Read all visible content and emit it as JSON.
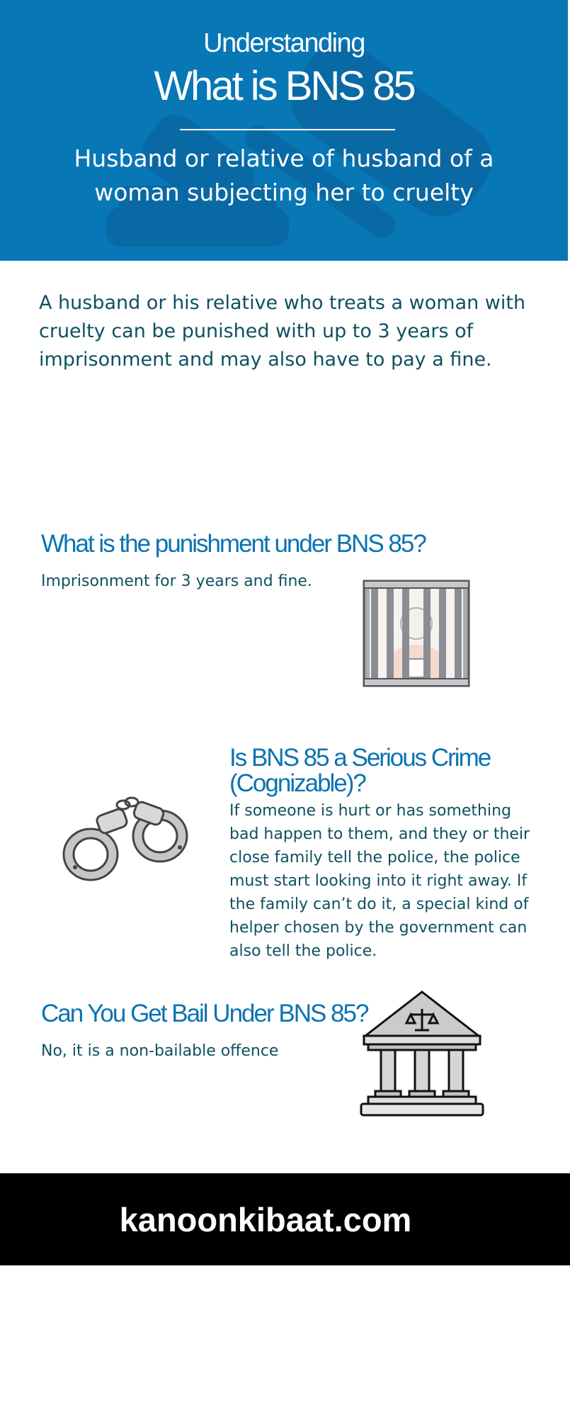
{
  "header": {
    "eyebrow": "Understanding",
    "title": "What is BNS 85",
    "subtitle": "Husband or relative of husband of a woman subjecting her to cruelty",
    "background_color": "#0777b6"
  },
  "intro": {
    "text": "A husband or his relative who treats a woman with cruelty can be punished with up to 3 years of imprisonment and may also have to pay a fine."
  },
  "punishment": {
    "heading": "What is the punishment under BNS 85?",
    "text": "Imprisonment for 3 years and fine.",
    "icon": "jail-icon"
  },
  "cognizable": {
    "heading": "Is BNS 85 a Serious Crime (Cognizable)?",
    "text": "If someone is hurt or has something bad happen to them, and they or their close family tell the police, the police must start looking into it right away. If the family can’t do it, a special kind of helper chosen by the government can also tell the police.",
    "icon": "handcuffs-icon"
  },
  "bail": {
    "heading": "Can You Get Bail Under BNS 85?",
    "text": "No, it is a non-bailable offence",
    "icon": "courthouse-icon"
  },
  "footer": {
    "site": "kanoonkibaat.com",
    "background_color": "#000000"
  },
  "colors": {
    "heading": "#0b73b3",
    "body_text": "#0f5160"
  }
}
